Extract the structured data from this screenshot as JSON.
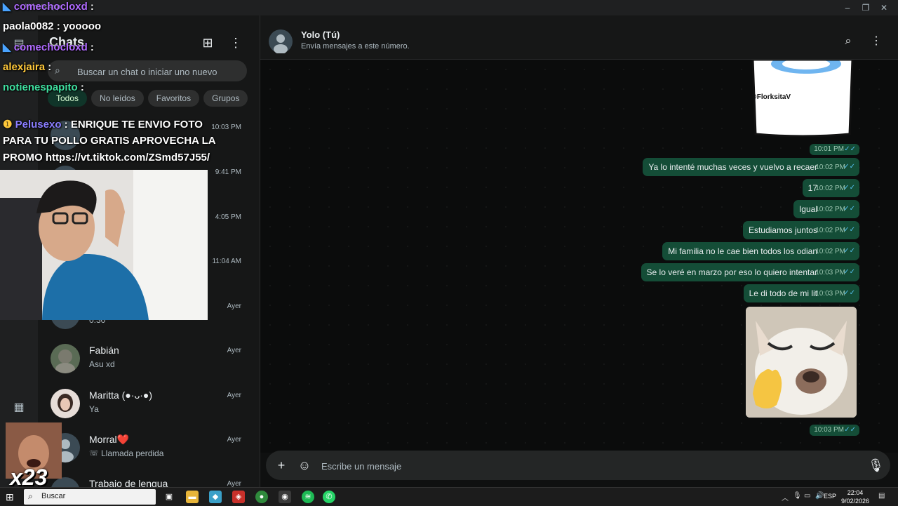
{
  "window": {
    "app_title": "WhatsApp"
  },
  "sidebar": {
    "title": "Chats",
    "search_placeholder": "Buscar un chat o iniciar uno nuevo",
    "filters": [
      "Todos",
      "No leídos",
      "Favoritos",
      "Grupos"
    ],
    "chats": [
      {
        "name": "",
        "preview": "",
        "time": "10:03 PM"
      },
      {
        "name": "",
        "preview": "",
        "time": "9:41 PM"
      },
      {
        "name": "",
        "preview": "",
        "time": "4:05 PM"
      },
      {
        "name": "",
        "preview": "",
        "time": "11:04 AM"
      },
      {
        "name": "",
        "preview": "0:30",
        "time": "Ayer"
      },
      {
        "name": "Fabián",
        "preview": "Asu xd",
        "time": "Ayer"
      },
      {
        "name": "Maritta (●·ᴗ·●)",
        "preview": "Ya",
        "time": "Ayer"
      },
      {
        "name": "Morral❤️",
        "preview": "Llamada perdida",
        "time": "Ayer"
      },
      {
        "name": "Trabajo de lengua",
        "preview": "",
        "time": "Ayer"
      }
    ]
  },
  "conversation": {
    "contact_name": "Yolo (Tú)",
    "contact_subtitle": "Envía mensajes a este número.",
    "sticker_caption": "@FlorksitaV",
    "sticker_time": "10:01 PM",
    "messages": [
      {
        "text": "Ya lo intenté muchas veces y vuelvo a recaer",
        "time": "10:02 PM"
      },
      {
        "text": "17",
        "time": "10:02 PM"
      },
      {
        "text": "Igual",
        "time": "10:02 PM"
      },
      {
        "text": "Estudiamos juntos",
        "time": "10:02 PM"
      },
      {
        "text": "Mi familia no le cae bien todos los odian",
        "time": "10:02 PM"
      },
      {
        "text": "Se lo veré en marzo por eso lo quiero intentar",
        "time": "10:03 PM"
      },
      {
        "text": "Le di todo de mi lit",
        "time": "10:03 PM"
      }
    ],
    "image_time": "10:03 PM",
    "composer_placeholder": "Escribe un mensaje"
  },
  "stream_overlay": {
    "lines": [
      {
        "user": "comechocloxd",
        "text": " :",
        "color": "#b06bff"
      },
      {
        "user": "paola0082",
        "text": " : yooooo",
        "color": "#ffffff"
      },
      {
        "user": "comechocloxd",
        "text": " :",
        "color": "#b06bff"
      },
      {
        "user": "alexjaira",
        "text": " :",
        "color": "#ffc83a"
      },
      {
        "user": "notienespapito",
        "text": " :",
        "color": "#3fe0a0"
      },
      {
        "user": "Pelusexo",
        "text": " : ENRIQUE TE ENVIO FOTO",
        "color": "#8a7dff"
      },
      {
        "user": "",
        "text": "PARA TU POLLO GRATIS APROVECHA LA",
        "color": "#ffffff"
      },
      {
        "user": "",
        "text": "PROMO https://vt.tiktok.com/ZSmd57J55/",
        "color": "#ffffff"
      }
    ],
    "combo_count": "x23"
  },
  "taskbar": {
    "search_label": "Buscar",
    "language": "ESP",
    "time": "22:04",
    "date": "9/02/2026"
  }
}
